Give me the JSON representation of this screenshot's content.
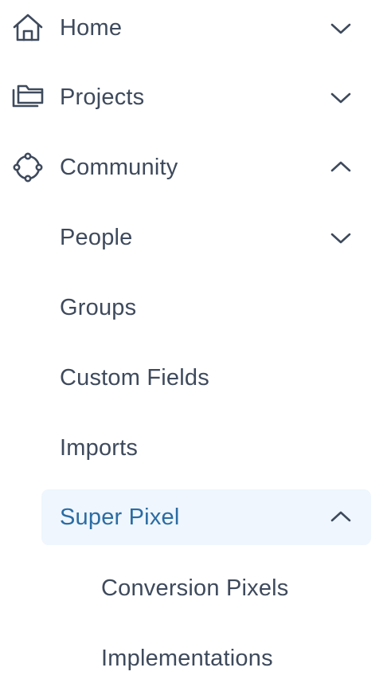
{
  "nav": {
    "items": [
      {
        "label": "Home",
        "icon": "home-icon",
        "expanded": false
      },
      {
        "label": "Projects",
        "icon": "folders-icon",
        "expanded": false
      },
      {
        "label": "Community",
        "icon": "community-icon",
        "expanded": true,
        "children": [
          {
            "label": "People",
            "expanded": false
          },
          {
            "label": "Groups"
          },
          {
            "label": "Custom Fields"
          },
          {
            "label": "Imports"
          },
          {
            "label": "Super Pixel",
            "expanded": true,
            "active": true,
            "children": [
              {
                "label": "Conversion Pixels"
              },
              {
                "label": "Implementations"
              }
            ]
          }
        ]
      }
    ]
  },
  "colors": {
    "text": "#3e4a5c",
    "active_text": "#2b6ca3",
    "active_bg": "#eff6fd"
  }
}
